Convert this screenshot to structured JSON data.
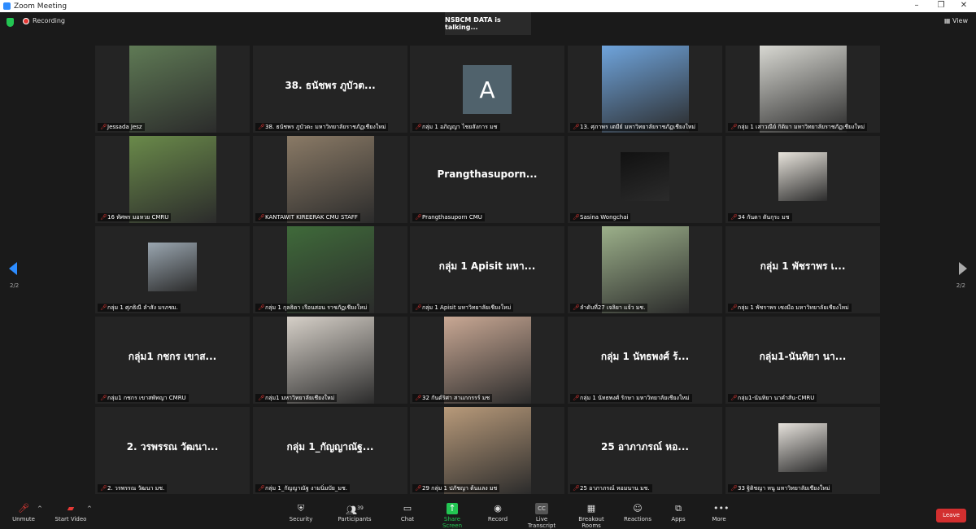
{
  "window": {
    "title": "Zoom Meeting"
  },
  "topbar": {
    "recording_label": "Recording",
    "talking": "NSBCM DATA is talking...",
    "view_label": "View"
  },
  "pager": {
    "left": "2/2",
    "right": "2/2"
  },
  "tiles": [
    {
      "name": "Jessada Jesz",
      "big": "",
      "photo": "#5f7a55"
    },
    {
      "name": "38. ธนัชพร ภูบัวตะ มหาวิทยาลัยราชภัฏเชียงใหม่",
      "big": "38. ธนัชพร ภูบัวต...",
      "photo": ""
    },
    {
      "name": "กลุ่ม 1 อภิญญา ไชยสังการ มช",
      "big": "",
      "photo": "",
      "avatar": "A"
    },
    {
      "name": "13. ศุภาพร เตมีย์ มหาวิทยาลัยราชภัฏเชียงใหม่",
      "big": "",
      "photo": "#6fa4dc"
    },
    {
      "name": "กลุ่ม 1 เสาวณีย์ กิติมา มหาวิทยาลัยราชภัฏเชียงใหม่",
      "big": "",
      "photo": "#d8d8d2"
    },
    {
      "name": "16 ทัศพร มอหวย CMRU",
      "big": "",
      "photo": "#6a8a4a"
    },
    {
      "name": "KANTAWIT KIREERAK CMU STAFF",
      "big": "",
      "photo": "#8a7a66"
    },
    {
      "name": "Prangthasuporn CMU",
      "big": "Prangthasuporn...",
      "photo": ""
    },
    {
      "name": "Sasina Wongchai",
      "big": "",
      "photo": "#111111"
    },
    {
      "name": "34 กันดา ตันกุระ มช",
      "big": "",
      "photo": "#e8e4dc"
    },
    {
      "name": "กลุ่ม 1 ศุภธิณี ลำสัง มรภชม.",
      "big": "",
      "photo": "#9aa6b0"
    },
    {
      "name": "กลุ่ม 1 กุลธิดา เรือนสอน ราชภัฏเชียงใหม่",
      "big": "",
      "photo": "#3f6a3a"
    },
    {
      "name": "กลุ่ม 1 Apisit มหาวิทยาลัยเชียงใหม่",
      "big": "กลุ่ม 1 Apisit มหา...",
      "photo": ""
    },
    {
      "name": "ลำดับที่27 เจลิยา แจ้ว มช.",
      "big": "",
      "photo": "#9cb08a"
    },
    {
      "name": "กลุ่ม 1 พัชราพร เซงมือ มหาวิทยาลัยเชียงใหม่",
      "big": "กลุ่ม 1 พัชราพร เ...",
      "photo": ""
    },
    {
      "name": "กลุ่ม1 กชกร เขาสพัทญา CMRU",
      "big": "กลุ่ม1 กชกร เขาส...",
      "photo": ""
    },
    {
      "name": "กลุ่ม1 มหาวิทยาลัยเชียงใหม่",
      "big": "",
      "photo": "#d6d0c8"
    },
    {
      "name": "32 กันต์ริศา สาแกกรรร์ มช",
      "big": "",
      "photo": "#c9a894"
    },
    {
      "name": "กลุ่ม 1 นัทธพงศ์ รักษา มหาวิทยาลัยเชียงใหม่",
      "big": "กลุ่ม 1 นัทธพงศ์ ร้...",
      "photo": ""
    },
    {
      "name": "กลุ่ม1-นันทิยา นาคำสัน-CMRU",
      "big": "กลุ่ม1-นันทิยา นา...",
      "photo": ""
    },
    {
      "name": "2. วรพรรณ วัฒนา มช.",
      "big": "2. วรพรรณ วัฒนา...",
      "photo": ""
    },
    {
      "name": "กลุ่ม 1_กัญญาณัฐ งามนิ่มบัย_มช.",
      "big": "กลุ่ม 1_กัญญาณัฐ...",
      "photo": ""
    },
    {
      "name": "29 กลุ่ม 1 ปภัชญา ต้นแลง มช",
      "big": "",
      "photo": "#b89a7a"
    },
    {
      "name": "25 อาภาภรณ์ หอมนาน มช.",
      "big": "25 อาภาภรณ์ หอ...",
      "photo": ""
    },
    {
      "name": "33 ฐิติชญา หนู มหาวิทยาลัยเชียงใหม่",
      "big": "",
      "photo": "#e6e2dc"
    }
  ],
  "toolbar": {
    "unmute": "Unmute",
    "start_video": "Start Video",
    "security": "Security",
    "participants": "Participants",
    "participants_count": "39",
    "chat": "Chat",
    "share": "Share Screen",
    "record": "Record",
    "transcript": "Live Transcript",
    "breakout": "Breakout Rooms",
    "reactions": "Reactions",
    "apps": "Apps",
    "more": "More",
    "leave": "Leave"
  },
  "colors": {
    "accent": "#2d8cff",
    "share_green": "#23c552",
    "leave_red": "#d32f2f"
  }
}
